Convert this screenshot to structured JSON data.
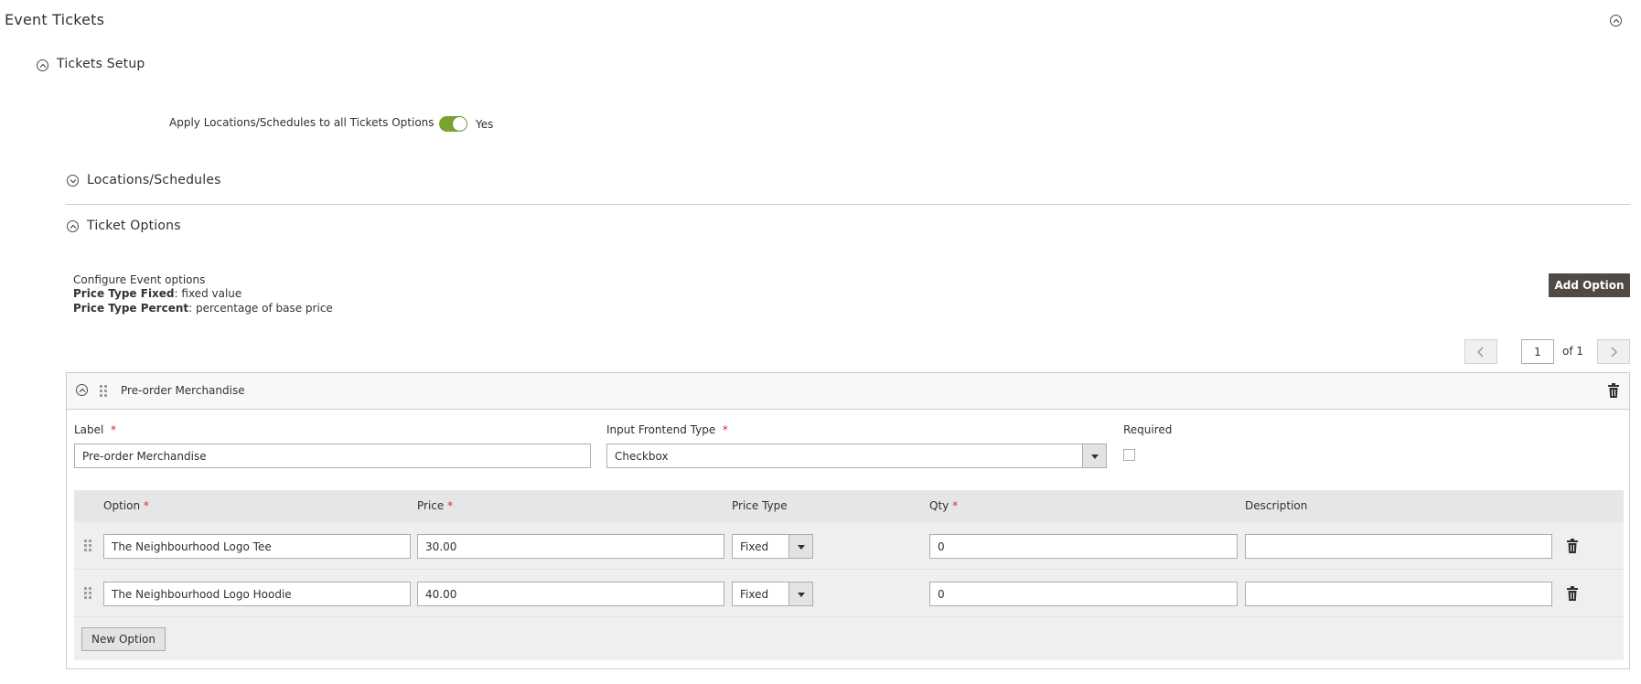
{
  "page": {
    "title": "Event Tickets",
    "section_tickets_setup": "Tickets Setup",
    "apply_label": "Apply Locations/Schedules to all Tickets Options",
    "apply_value": "Yes",
    "section_locations": "Locations/Schedules",
    "section_ticket_options": "Ticket Options"
  },
  "info": {
    "line1": "Configure Event options",
    "fixed_label": "Price Type Fixed",
    "fixed_text": ": fixed value",
    "percent_label": "Price Type Percent",
    "percent_text": ": percentage of base price"
  },
  "toolbar": {
    "add_option": "Add Option"
  },
  "pager": {
    "current": "1",
    "of_text": "of 1"
  },
  "option_group": {
    "title": "Pre-order Merchandise",
    "label_caption": "Label",
    "label_value": "Pre-order Merchandise",
    "input_type_caption": "Input Frontend Type",
    "input_type_value": "Checkbox",
    "required_caption": "Required",
    "columns": {
      "option": "Option",
      "price": "Price",
      "price_type": "Price Type",
      "qty": "Qty",
      "description": "Description"
    },
    "rows": [
      {
        "option": "The Neighbourhood Logo Tee",
        "price": "30.00",
        "price_type": "Fixed",
        "qty": "0",
        "description": ""
      },
      {
        "option": "The Neighbourhood Logo Hoodie",
        "price": "40.00",
        "price_type": "Fixed",
        "qty": "0",
        "description": ""
      }
    ],
    "new_option": "New Option"
  },
  "colors": {
    "toggle_on": "#79a22e",
    "dark_button": "#514943",
    "required_star": "#e22626"
  }
}
